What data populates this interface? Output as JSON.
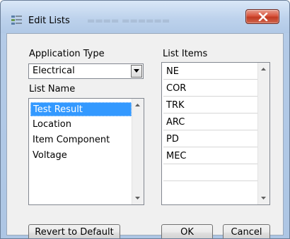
{
  "window": {
    "title": "Edit Lists",
    "close_glyph": "X"
  },
  "application_type": {
    "label": "Application Type",
    "selected": "Electrical"
  },
  "list_name": {
    "label": "List Name",
    "items": [
      "Test Result",
      "Location",
      "Item Component",
      "Voltage"
    ],
    "selected_index": 0
  },
  "list_items": {
    "label": "List Items",
    "items": [
      "NE",
      "COR",
      "TRK",
      "ARC",
      "PD",
      "MEC",
      ""
    ]
  },
  "buttons": {
    "revert": "Revert to Default",
    "ok": "OK",
    "cancel": "Cancel"
  },
  "colors": {
    "selection": "#3399ff",
    "close_button": "#c13a22",
    "titlebar": "#bdd2ec"
  }
}
